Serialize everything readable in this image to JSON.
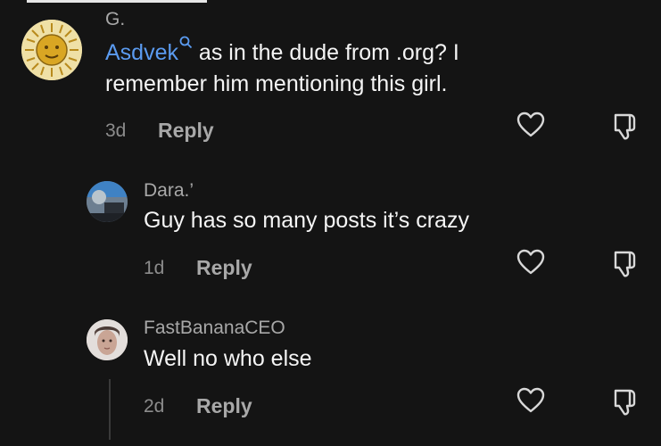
{
  "comments": [
    {
      "username": "G.",
      "mention": "Asdvek",
      "text": " as in the dude from .org? I",
      "text_line2": "remember him mentioning this girl.",
      "time": "3d",
      "reply_label": "Reply",
      "avatar": "sun-emblem"
    },
    {
      "username": "Dara.’",
      "text": "Guy has so many posts it’s crazy",
      "time": "1d",
      "reply_label": "Reply",
      "avatar": "photo"
    },
    {
      "username": "FastBananaCEO",
      "text": "Well no who else",
      "time": "2d",
      "reply_label": "Reply",
      "avatar": "photo"
    }
  ],
  "icons": {
    "like": "heart-outline-icon",
    "dislike": "thumbs-down-icon",
    "mention_search": "search-icon"
  },
  "colors": {
    "background": "#141414",
    "mention": "#5b9bf0",
    "secondary_text": "#a8a8a8"
  }
}
